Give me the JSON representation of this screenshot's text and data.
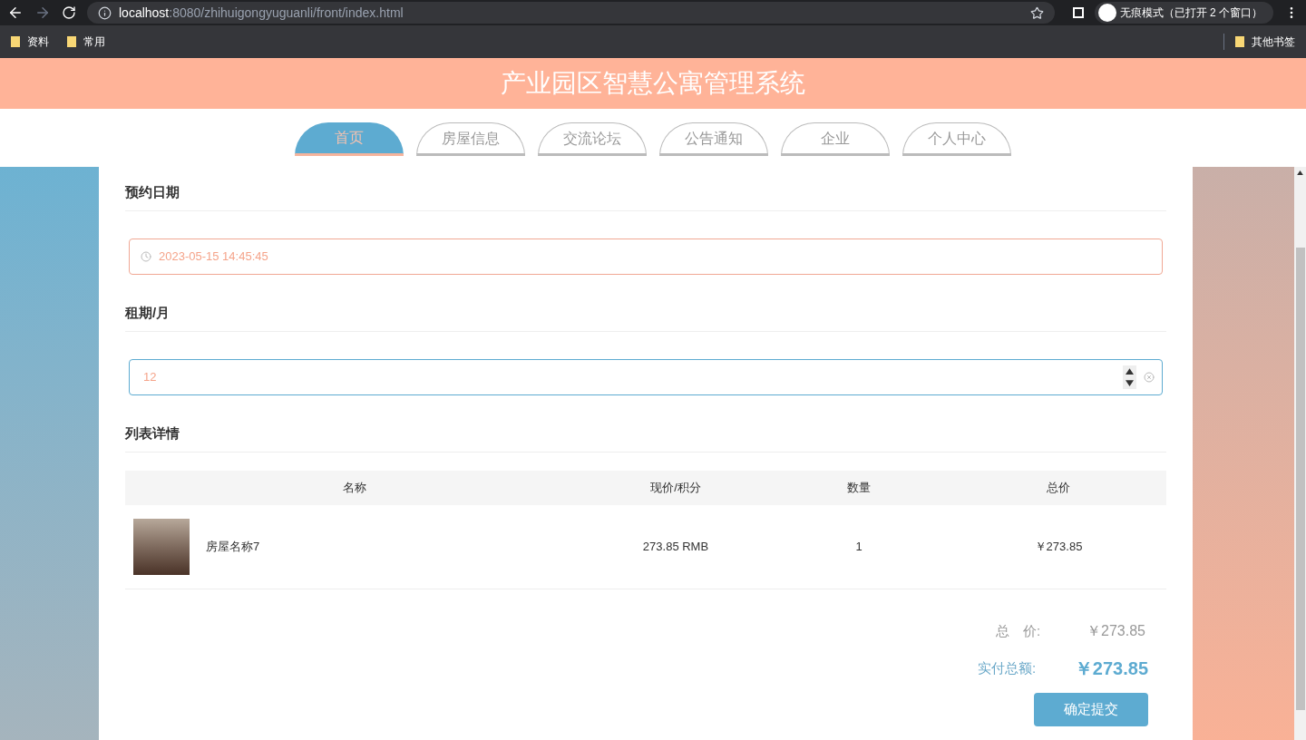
{
  "browser": {
    "url_host": "localhost",
    "url_path": ":8080/zhihuigongyuguanli/front/index.html",
    "profile": "无痕模式（已打开 2 个窗口）",
    "bookmarks": [
      "资料",
      "常用"
    ],
    "other_bookmarks": "其他书签"
  },
  "site_title": "产业园区智慧公寓管理系统",
  "nav": [
    {
      "label": "首页",
      "selected": true
    },
    {
      "label": "房屋信息",
      "selected": false
    },
    {
      "label": "交流论坛",
      "selected": false
    },
    {
      "label": "公告通知",
      "selected": false
    },
    {
      "label": "企业",
      "selected": false
    },
    {
      "label": "个人中心",
      "selected": false
    }
  ],
  "form": {
    "date_label": "预约日期",
    "date_value": "2023-05-15 14:45:45",
    "term_label": "租期/月",
    "term_value": "12"
  },
  "list_title": "列表详情",
  "table": {
    "columns": [
      "名称",
      "现价/积分",
      "数量",
      "总价"
    ],
    "rows": [
      {
        "name": "房屋名称7",
        "price": "273.85 RMB",
        "qty": "1",
        "total": "￥273.85"
      }
    ]
  },
  "summary": {
    "total_label": "总　价:",
    "total_value": "￥273.85",
    "paid_label": "实付总额:",
    "paid_value": "￥273.85",
    "submit": "确定提交"
  }
}
